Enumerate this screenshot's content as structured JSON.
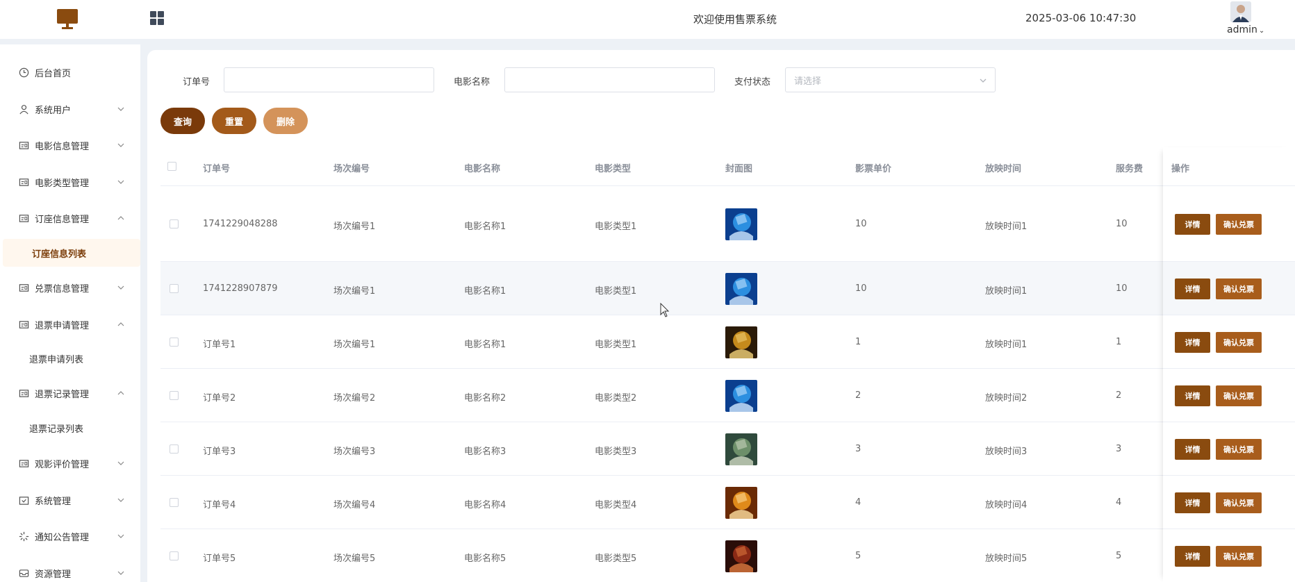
{
  "header": {
    "welcome": "欢迎使用售票系统",
    "datetime": "2025-03-06 10:47:30",
    "user": "admin",
    "brand_color": "#8a4b0f"
  },
  "sidebar": {
    "items": [
      {
        "label": "后台首页",
        "icon": "clock-icon"
      },
      {
        "label": "系统用户",
        "icon": "user-icon",
        "chevron": "down"
      },
      {
        "label": "电影信息管理",
        "icon": "card-icon",
        "chevron": "down"
      },
      {
        "label": "电影类型管理",
        "icon": "card-icon",
        "chevron": "down"
      },
      {
        "label": "订座信息管理",
        "icon": "card-icon",
        "chevron": "up"
      },
      {
        "label": "订座信息列表",
        "sub": true,
        "active": true
      },
      {
        "label": "兑票信息管理",
        "icon": "card-icon",
        "chevron": "down"
      },
      {
        "label": "退票申请管理",
        "icon": "card-icon",
        "chevron": "up"
      },
      {
        "label": "退票申请列表",
        "sub": true
      },
      {
        "label": "退票记录管理",
        "icon": "card-icon",
        "chevron": "up"
      },
      {
        "label": "退票记录列表",
        "sub": true
      },
      {
        "label": "观影评价管理",
        "icon": "card-icon",
        "chevron": "down"
      },
      {
        "label": "系统管理",
        "icon": "folder-icon",
        "chevron": "down"
      },
      {
        "label": "通知公告管理",
        "icon": "spinner-icon",
        "chevron": "down"
      },
      {
        "label": "资源管理",
        "icon": "inbox-icon",
        "chevron": "down"
      }
    ]
  },
  "filters": {
    "order_label": "订单号",
    "order_value": "",
    "movie_label": "电影名称",
    "movie_value": "",
    "pay_label": "支付状态",
    "pay_placeholder": "请选择"
  },
  "buttons": {
    "query": "查询",
    "reset": "重置",
    "delete": "删除",
    "query_color": "#7a3a0a",
    "reset_color": "#a35a1a",
    "delete_color": "#d4935a"
  },
  "table": {
    "headers": [
      "订单号",
      "场次编号",
      "电影名称",
      "电影类型",
      "封面图",
      "影票单价",
      "放映时间",
      "服务费",
      "操作"
    ],
    "detail_label": "详情",
    "confirm_label": "确认兑票",
    "rows": [
      {
        "order": "1741229048288",
        "session": "场次编号1",
        "movie": "电影名称1",
        "type": "电影类型1",
        "cover": "blue",
        "price": "10",
        "time": "放映时间1",
        "fee": "10"
      },
      {
        "order": "1741228907879",
        "session": "场次编号1",
        "movie": "电影名称1",
        "type": "电影类型1",
        "cover": "blue",
        "price": "10",
        "time": "放映时间1",
        "fee": "10"
      },
      {
        "order": "订单号1",
        "session": "场次编号1",
        "movie": "电影名称1",
        "type": "电影类型1",
        "cover": "gold",
        "price": "1",
        "time": "放映时间1",
        "fee": "1"
      },
      {
        "order": "订单号2",
        "session": "场次编号2",
        "movie": "电影名称2",
        "type": "电影类型2",
        "cover": "blue",
        "price": "2",
        "time": "放映时间2",
        "fee": "2"
      },
      {
        "order": "订单号3",
        "session": "场次编号3",
        "movie": "电影名称3",
        "type": "电影类型3",
        "cover": "green",
        "price": "3",
        "time": "放映时间3",
        "fee": "3"
      },
      {
        "order": "订单号4",
        "session": "场次编号4",
        "movie": "电影名称4",
        "type": "电影类型4",
        "cover": "orange",
        "price": "4",
        "time": "放映时间4",
        "fee": "4"
      },
      {
        "order": "订单号5",
        "session": "场次编号5",
        "movie": "电影名称5",
        "type": "电影类型5",
        "cover": "red",
        "price": "5",
        "time": "放映时间5",
        "fee": "5"
      }
    ]
  }
}
